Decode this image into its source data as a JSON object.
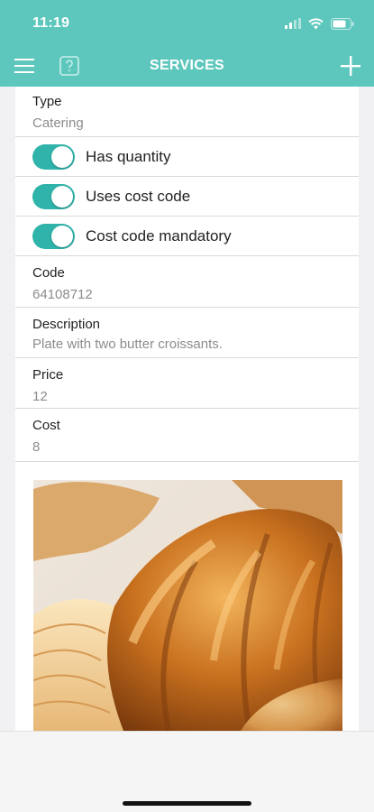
{
  "status_bar": {
    "time": "11:19"
  },
  "header": {
    "title": "SERVICES"
  },
  "form": {
    "type": {
      "label": "Type",
      "value": "Catering"
    },
    "toggles": [
      {
        "label": "Has quantity",
        "on": true
      },
      {
        "label": "Uses cost code",
        "on": true
      },
      {
        "label": "Cost code mandatory",
        "on": true
      }
    ],
    "code": {
      "label": "Code",
      "value": "64108712"
    },
    "description": {
      "label": "Description",
      "value": "Plate with two butter croissants."
    },
    "price": {
      "label": "Price",
      "value": "12"
    },
    "cost": {
      "label": "Cost",
      "value": "8"
    }
  },
  "colors": {
    "accent": "#5ec7bd",
    "toggle_on": "#2fb3aa",
    "value_text": "#8c8c8c"
  },
  "icons": [
    "menu-icon",
    "help-icon",
    "plus-icon",
    "signal-icon",
    "wifi-icon",
    "battery-icon"
  ]
}
